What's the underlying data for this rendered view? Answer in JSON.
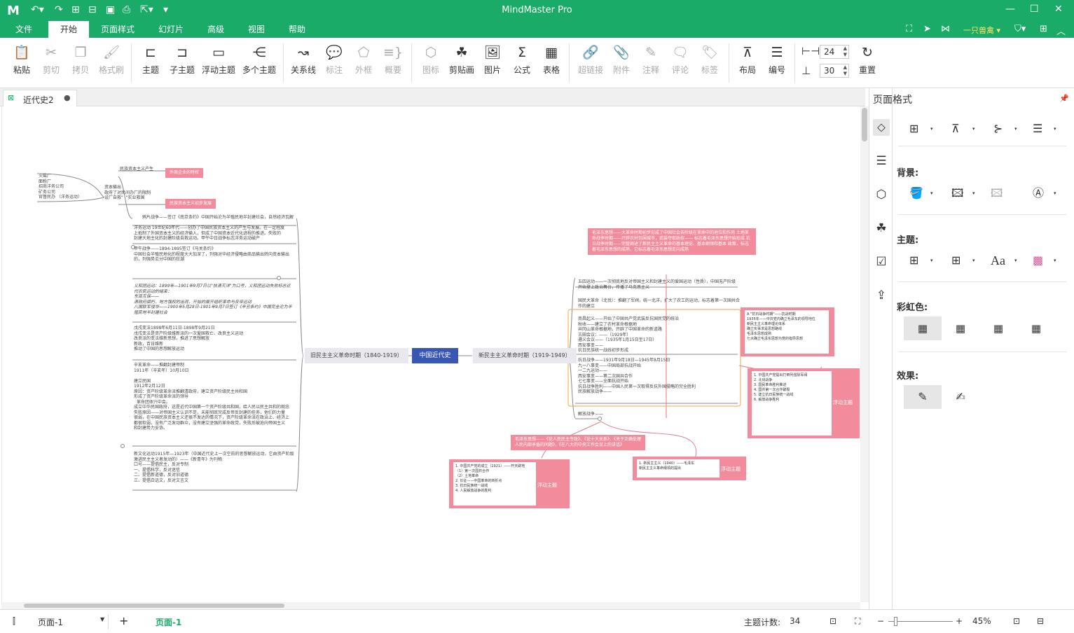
{
  "app": {
    "title": "MindMaster Pro",
    "logo": "M"
  },
  "quick_access": [
    "undo-icon",
    "redo-icon",
    "new-icon",
    "open-icon",
    "save-icon",
    "print-icon",
    "export-icon"
  ],
  "menu": {
    "tabs": [
      "文件",
      "开始",
      "页面样式",
      "幻灯片",
      "高级",
      "视图",
      "帮助"
    ],
    "active": "开始",
    "user": "一只兽禽"
  },
  "ribbon": {
    "paste": "粘贴",
    "cut": "剪切",
    "copy": "拷贝",
    "format_painter": "格式刷",
    "topic": "主题",
    "subtopic": "子主题",
    "floating_topic": "浮动主题",
    "multiple_topics": "多个主题",
    "relationship": "关系线",
    "callout": "标注",
    "boundary": "外框",
    "summary": "概要",
    "icon": "图标",
    "clipart": "剪贴画",
    "picture": "图片",
    "formula": "公式",
    "table": "表格",
    "hyperlink": "超链接",
    "attachment": "附件",
    "note": "注释",
    "comment": "评论",
    "tag": "标签",
    "layout": "布局",
    "numbering": "编号",
    "h_spacing": "24",
    "v_spacing": "30",
    "reset": "重置"
  },
  "document": {
    "tab_title": "近代史2"
  },
  "mindmap": {
    "central": "中国近代史",
    "left_main": "旧民主主义革命时期（1840-1919）",
    "right_main": "新民主主义革命时期（1919-1949）",
    "left_top_pink1": "外商企业的特权",
    "left_top_pink2": "民族资本主义初步发展",
    "left_top_label": "民族资本主义产生",
    "left_far_text": "火柴厂\n面粉厂\n招商洋务公司\n矿务公司\n官督民办 （洋务运动）",
    "left_far_text2": "资本输出\n政府了对民间办厂的限制\n设厂自救\"  \"实业救国",
    "left_block1": "鸦片战争——签订《南京条约》中国开始沦为半殖民地半封建社会，自然经济瓦解",
    "left_block2": "洋务运动 19世纪60年代——创办了中国民族资本主义的产生与发展。在一定程度\n上抵制了外国资本主义的经济输入，但成了中国资本近代化进程的推进。失败的\n封建大地主化的封建阶级自救运动。甲午中日战争标志洋务运动破产",
    "left_block3": "甲午战争——1894-1895签订《马关条约》\n中国社会半殖民地化的程度大大加深了，列强对华经济侵略由商品输出转向资本输出\n的，列强势瓜分中国的狂潮",
    "left_block4": "义和团运动：1899年—1901年9月7日以\"扶清灭洋\"为口号，义和团运动失败标志近\n代农民运动的结束：\n东南互保——\n清政府腐朽，地方强权的出现，开始的展开组织革命与反帝运动\n八国联军侵华——1900年5月28日-1901年9月7日签订《辛丑条约》中国完全沦为半\n殖民地半封建社会",
    "left_block5": "戊戌变法1898年6月11日-1898年9月21日\n戊戌变法是资产阶级维新派的一次爱国救亡、改良主义运动\n改良派的变法维新思想，推进了思想解放\n新政，百日维新\n推动了中国的思想解放运动",
    "left_block6": "辛亥革命——推翻封建帝制\n1911年（辛亥年）10月10日\n\n建立民国\n1912年2月12日\n原因：资产阶级革命派推翻清政府，建立资产阶级民主共和国\n形成了资产阶级革命派的领导\n  革命团体兴中会。\n成立中华民国政府，这是近代中国第一个资产阶级共和国，给人民以民主共和的观念\n失败原因——对帝国主义认识不足，未能彻底完成反帝反封建的任务，他们的力量\n很弱，在中国民族资本主义还很不发达的情况下，资产阶级革命派在政治上、经济上\n都很软弱，没有广泛发动群众，没有建立坚强的革命政党，失败后被迫向帝国主义\n和封建势力妥协。",
    "left_block7": "新文化运动1915年—1923年（中国近代史上一次空前的思想解放运动，它由资产阶级\n激进民主主义者发动的）——《新青年》为刊物\n口号——提倡民主，反对专制\n一、提倡科学，反对迷信\n二、提倡新道德，反对旧道德\n三、提倡白话文，反对文言文",
    "right_pink_top": "毛泽东思想——大革命时期初步形成了中国社会各阶级在革命中的地位和作用\n土地革命战争时期——开辟农村包围城市，武装夺取政权——\n标志着毛泽东思想开始形成\n抗日战争时期——完整阐述了新民主主义革命的基本理论、基本纲领和基本\n政策，标志着毛泽东思想的成熟，它标志着毛泽东思想走向成熟",
    "right_block1": "五四运动——一次彻底地反对帝国主义和封建主义的爱国运动（性质），中国无产阶级\n开始登上政治舞台，传播了马克思主义",
    "right_block2": "国民大革命（北伐）：推翻了军阀，统一北洋，扩大了农工的运动，标志着第一次国共合\n作的建立",
    "right_block3": "南昌起义——开始了中国共产党武装反抗国民党的统治\n秋收——建立了农村革命根据地\n井冈山革命根据地，开辟了中国革命的新道路\n古田会议：——（1929年）\n遵义会议——（1935年1月15日至17日）\n西安事变——\n抗日民族统一战线初步形成",
    "right_block4": "抗日战争——1931年9月18日—1945年8月15日\n九一八事变——中国局部抗战开始\n一二九运动——\n西安事变——第二次国共合作\n七七事变——全面抗战开始\n抗日战争胜利——中国人民第一次取得反抗外国侵略的完全胜利\n民族解放战争——",
    "right_block5": "解放战争——",
    "right_pink_mid": "毛泽东思想——《论人民民主专政》、《论十大关系》、《关于正确处理\n人民内部矛盾的问题》，《在八大的中央工作会议上的讲话》",
    "float_label": "浮动主题",
    "float1_text": "A \"抗日战争时期\"——抗战时期\n1935年——中共党内确立毛泽东的领导地位\n新民主主义革命理论体系\n确立实事求是思想路线\n毛泽东思想成熟\n七大确立毛泽东思想为党的指导思想",
    "float2_text": "1. 中国共产党提出打倒列强除军阀\n2. 北伐战争\n3. 国民革命胜利推进\n4. 国共第一次合作破裂\n5. 建立抗日民族统一战线\n6. 解放战争胜利",
    "float3_text": "1. 中国共产党的成立（1921）——开天辟地\n（1）第一次国共合作\n（2）土地革命\n2. 长征——中国革命的转折点\n3. 抗日民族统一战线\n4. 人民解放战争的胜利",
    "float4_text": "1. 新民主主义（1940）——毛泽东\n新民主主义革命纲领的提出"
  },
  "right_panel": {
    "title": "页面格式",
    "background_label": "背景:",
    "theme_label": "主题:",
    "rainbow_label": "彩虹色:",
    "effect_label": "效果:",
    "font_button": "Aa"
  },
  "statusbar": {
    "page_select": "页面-1",
    "active_page": "页面-1",
    "topic_count_label": "主题计数:",
    "topic_count": "34",
    "zoom": "45%"
  }
}
